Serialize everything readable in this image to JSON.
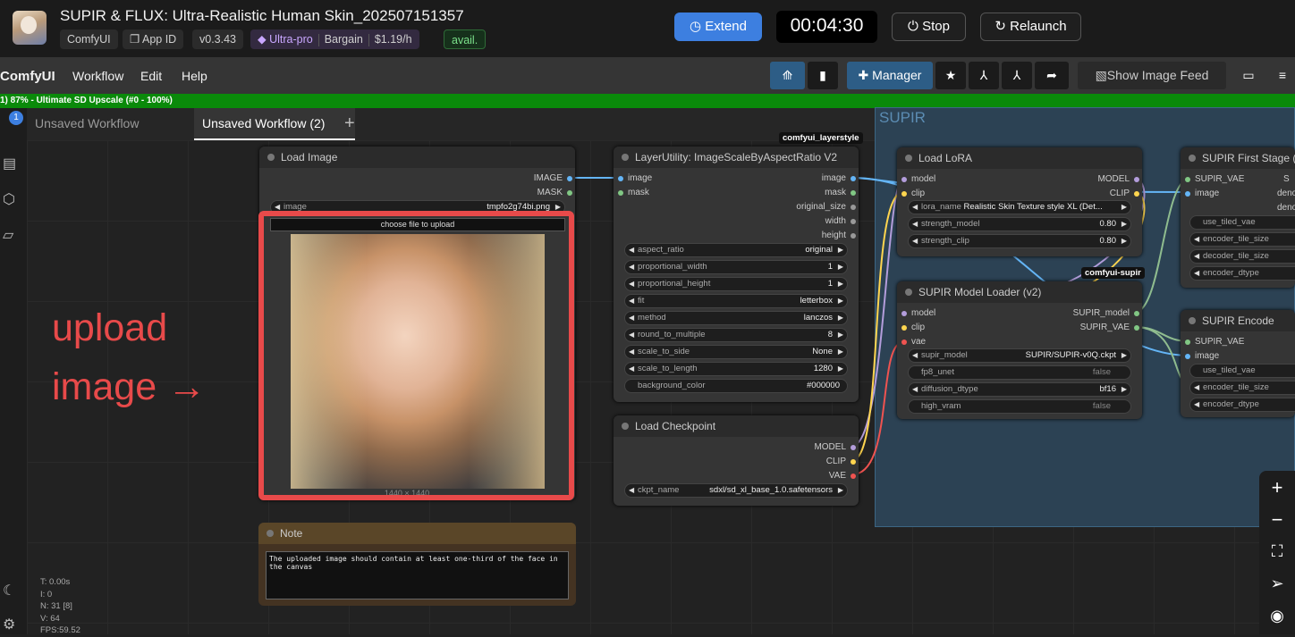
{
  "app": {
    "title": "SUPIR & FLUX: Ultra-Realistic Human Skin_202507151357",
    "platform": "ComfyUI",
    "app_id": "App ID",
    "version": "v0.3.43",
    "plan": "Ultra-pro",
    "tier": "Bargain",
    "price": "$1.19/h",
    "availability": "avail.",
    "extend": "Extend",
    "timer": "00:04:30",
    "stop": "Stop",
    "relaunch": "Relaunch"
  },
  "menu": {
    "logo": "ComfyUI",
    "items": [
      "Workflow",
      "Edit",
      "Help"
    ],
    "manager": "Manager",
    "image_feed": "Show Image Feed"
  },
  "progress": {
    "text": "1) 87% - Ultimate SD Upscale (#0 - 100%)",
    "fraction": 0.87
  },
  "tabs": [
    {
      "label": "Unsaved Workflow"
    },
    {
      "label": "Unsaved Workflow (2)"
    }
  ],
  "queue_badge": "1",
  "group": {
    "title": "SUPIR"
  },
  "annotation": {
    "line1": "upload",
    "line2": "image →"
  },
  "nodes": {
    "load_image": {
      "title": "Load Image",
      "outputs": [
        "IMAGE",
        "MASK"
      ],
      "image_label": "image",
      "image_value": "tmpfo2g74bi.png",
      "upload": "choose file to upload",
      "size_text": "1440 × 1440"
    },
    "note": {
      "title": "Note",
      "text": "The uploaded image should contain at least one-third of the face in the canvas"
    },
    "scale": {
      "tag": "comfyui_layerstyle",
      "title": "LayerUtility: ImageScaleByAspectRatio V2",
      "inputs": [
        "image",
        "mask"
      ],
      "outputs": [
        "image",
        "mask",
        "original_size",
        "width",
        "height"
      ],
      "widgets": [
        [
          "aspect_ratio",
          "original"
        ],
        [
          "proportional_width",
          "1"
        ],
        [
          "proportional_height",
          "1"
        ],
        [
          "fit",
          "letterbox"
        ],
        [
          "method",
          "lanczos"
        ],
        [
          "round_to_multiple",
          "8"
        ],
        [
          "scale_to_side",
          "None"
        ],
        [
          "scale_to_length",
          "1280"
        ],
        [
          "background_color",
          "#000000"
        ]
      ]
    },
    "checkpoint": {
      "title": "Load Checkpoint",
      "outputs": [
        "MODEL",
        "CLIP",
        "VAE"
      ],
      "widget": [
        "ckpt_name",
        "sdxl/sd_xl_base_1.0.safetensors"
      ]
    },
    "lora": {
      "title": "Load LoRA",
      "inputs": [
        "model",
        "clip"
      ],
      "outputs": [
        "MODEL",
        "CLIP"
      ],
      "widgets": [
        [
          "lora_name",
          "Realistic Skin Texture style XL (Det..."
        ],
        [
          "strength_model",
          "0.80"
        ],
        [
          "strength_clip",
          "0.80"
        ]
      ]
    },
    "supir_loader": {
      "tag": "comfyui-supir",
      "title": "SUPIR Model Loader (v2)",
      "inputs": [
        "model",
        "clip",
        "vae"
      ],
      "outputs": [
        "SUPIR_model",
        "SUPIR_VAE"
      ],
      "widgets": [
        [
          "supir_model",
          "SUPIR/SUPIR-v0Q.ckpt"
        ],
        [
          "fp8_unet",
          "false"
        ],
        [
          "diffusion_dtype",
          "bf16"
        ],
        [
          "high_vram",
          "false"
        ]
      ]
    },
    "first_stage": {
      "title": "SUPIR First Stage (D",
      "inputs": [
        "SUPIR_VAE",
        "image"
      ],
      "outputs_partial": [
        "S",
        "deno",
        "deno"
      ],
      "widgets": [
        "use_tiled_vae",
        "encoder_tile_size",
        "decoder_tile_size",
        "encoder_dtype"
      ]
    },
    "encode": {
      "title": "SUPIR Encode",
      "inputs": [
        "SUPIR_VAE",
        "image"
      ],
      "widgets": [
        "use_tiled_vae",
        "encoder_tile_size",
        "encoder_dtype"
      ]
    }
  },
  "stats": {
    "t": "T: 0.00s",
    "i": "I: 0",
    "n": "N: 31 [8]",
    "v": "V: 64",
    "fps": "FPS:59.52"
  },
  "colors": {
    "accent": "#3d7fe0",
    "annotation": "#e84a4a",
    "progress": "#0a8a0a",
    "group": "#2d4457"
  }
}
